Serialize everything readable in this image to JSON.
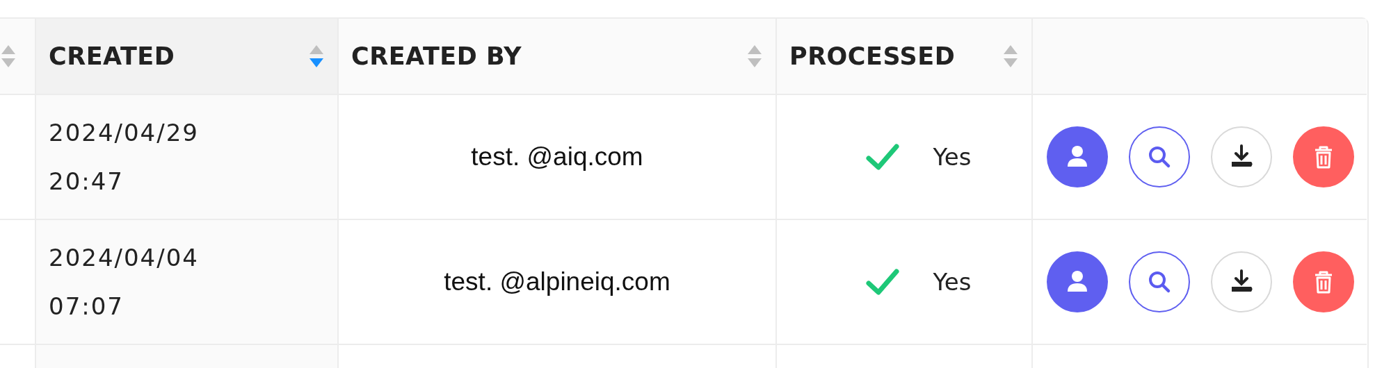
{
  "table": {
    "columns": [
      {
        "sortable": true,
        "sorted_ascending": false,
        "sorted_descending": false
      },
      {
        "label": "CREATED",
        "sortable": true,
        "sorted_ascending": false,
        "sorted_descending": true
      },
      {
        "label": "CREATED BY",
        "sortable": true,
        "sorted_ascending": false,
        "sorted_descending": false
      },
      {
        "label": "PROCESSED",
        "sortable": true,
        "sorted_ascending": false,
        "sorted_descending": false
      },
      {
        "sortable": false
      }
    ],
    "rows": [
      {
        "created_date": "2024/04/29",
        "created_time": "20:47",
        "created_by": "test. @aiq.com",
        "processed": true,
        "processed_label": "Yes"
      },
      {
        "created_date": "2024/04/04",
        "created_time": "07:07",
        "created_by": "test. @alpineiq.com",
        "processed": true,
        "processed_label": "Yes"
      }
    ]
  }
}
